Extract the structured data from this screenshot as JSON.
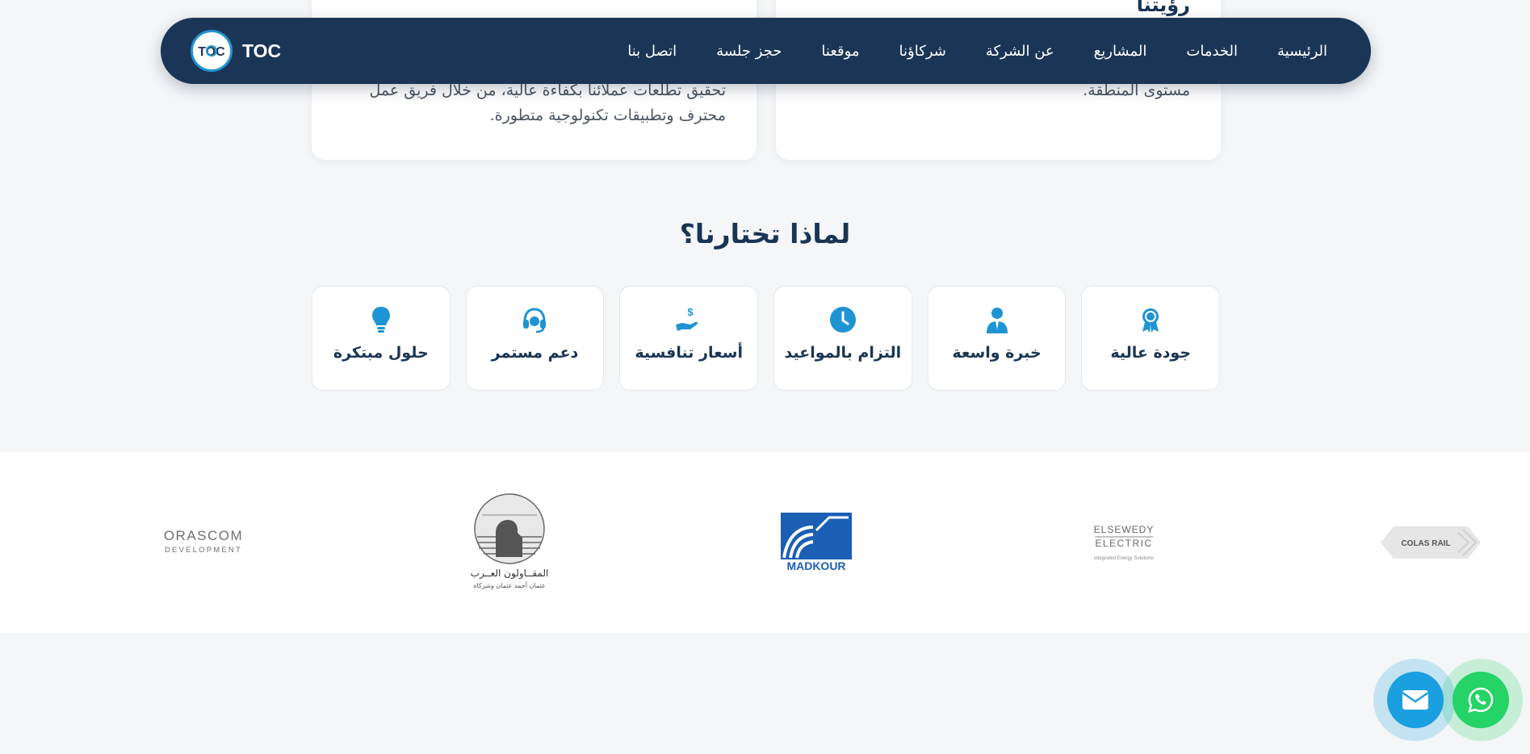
{
  "vision_card": {
    "heading": "رؤيتنا",
    "body": "مستوى المنطقة."
  },
  "mission_card": {
    "body": "تحقيق تطلعات عملائنا بكفاءة عالية، من خلال فريق عمل محترف وتطبيقات تكنولوجية متطورة."
  },
  "navbar": {
    "brand": "TOC",
    "items": [
      "الرئيسية",
      "الخدمات",
      "المشاريع",
      "عن الشركة",
      "شركاؤنا",
      "موقعنا",
      "حجز جلسة",
      "اتصل بنا"
    ]
  },
  "why": {
    "title": "لماذا تختارنا؟",
    "features": [
      {
        "label": "جودة عالية",
        "icon": "award-icon"
      },
      {
        "label": "خبرة واسعة",
        "icon": "user-tie-icon"
      },
      {
        "label": "التزام بالمواعيد",
        "icon": "clock-icon"
      },
      {
        "label": "أسعار تنافسية",
        "icon": "hand-dollar-icon"
      },
      {
        "label": "دعم مستمر",
        "icon": "headset-icon"
      },
      {
        "label": "حلول مبتكرة",
        "icon": "lightbulb-icon"
      }
    ]
  },
  "partners": {
    "orascom": {
      "line1": "ORASCOM",
      "line2": "DEVELOPMENT"
    },
    "arab_contractors": {
      "line1": "المقــاولون العــرب",
      "line2": "عثمان أحمد عثمان وشركاه"
    },
    "madkour": {
      "name": "MADKOUR"
    },
    "elsewedy": {
      "line1": "ELSEWEDY",
      "line2": "ELECTRIC",
      "tagline": "Integrated Energy Solutions"
    },
    "colas": {
      "name": "COLAS RAIL"
    }
  },
  "colors": {
    "navy": "#1b3556",
    "accent": "#1f94d2",
    "whatsapp": "#25d366",
    "email": "#1a9fe0"
  },
  "floating": {
    "whatsapp_icon": "whatsapp-icon",
    "email_icon": "envelope-icon"
  }
}
